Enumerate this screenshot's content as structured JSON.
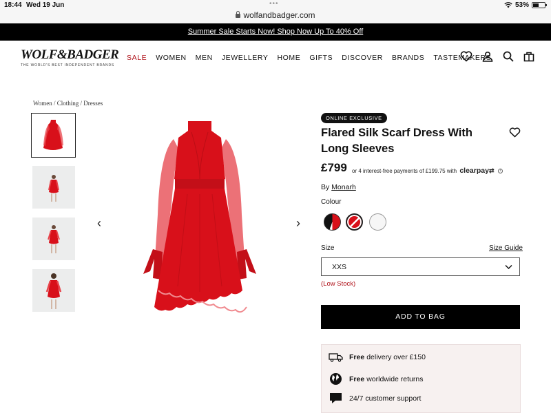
{
  "status_bar": {
    "time": "18:44",
    "date": "Wed 19 Jun",
    "url": "wolfandbadger.com",
    "battery": "53%",
    "battery_level": 0.53,
    "dots": "•••"
  },
  "promo": {
    "text": "Summer Sale Starts Now! Shop Now Up To 40% Off"
  },
  "header": {
    "logo": "WOLF&BADGER",
    "tagline": "THE WORLD'S BEST INDEPENDENT BRANDS",
    "nav": [
      "SALE",
      "WOMEN",
      "MEN",
      "JEWELLERY",
      "HOME",
      "GIFTS",
      "DISCOVER",
      "BRANDS",
      "TASTEMAKERS"
    ],
    "icons": [
      "heart-icon",
      "account-icon",
      "search-icon",
      "bag-icon"
    ]
  },
  "breadcrumb": "Women / Clothing / Dresses",
  "gallery": {
    "thumb_count": 4,
    "prev_arrow": "‹",
    "next_arrow": "›"
  },
  "product": {
    "badge": "ONLINE EXCLUSIVE",
    "title": "Flared Silk Scarf Dress With Long Sleeves",
    "price": "£799",
    "installments": "or 4 interest-free payments of £199.75 with",
    "clearpay": "clearpay",
    "info": "i",
    "by_prefix": "By",
    "brand": "Monarh",
    "colour_label": "Colour",
    "size_label": "Size",
    "size_guide": "Size Guide",
    "size_value": "XXS",
    "stock": "(Low Stock)",
    "add_to_bag": "ADD TO BAG"
  },
  "perks": [
    {
      "bold": "Free",
      "text": "delivery over £150",
      "icon": "truck-icon"
    },
    {
      "bold": "Free",
      "text": "worldwide returns",
      "icon": "globe-icon"
    },
    {
      "bold": "",
      "text": "24/7 customer support",
      "icon": "chat-icon"
    }
  ],
  "colors": {
    "accent_red": "#b0121a",
    "dress_red": "#d8101a",
    "black": "#000000"
  }
}
